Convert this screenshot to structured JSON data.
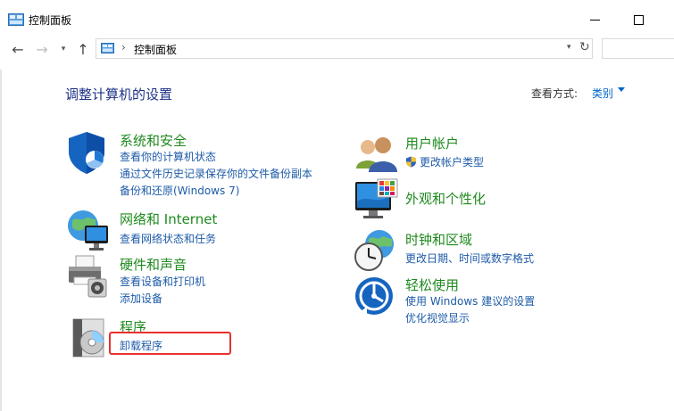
{
  "window": {
    "title": "控制面板"
  },
  "address": {
    "path": "控制面板"
  },
  "page": {
    "title": "调整计算机的设置",
    "view_by_label": "查看方式:",
    "view_by_value": "类别"
  },
  "categories": {
    "system_security": {
      "title": "系统和安全",
      "links": [
        "查看你的计算机状态",
        "通过文件历史记录保存你的文件备份副本",
        "备份和还原(Windows 7)"
      ]
    },
    "network": {
      "title": "网络和 Internet",
      "links": [
        "查看网络状态和任务"
      ]
    },
    "hardware": {
      "title": "硬件和声音",
      "links": [
        "查看设备和打印机",
        "添加设备"
      ]
    },
    "programs": {
      "title": "程序",
      "links": [
        "卸载程序"
      ]
    },
    "user_accounts": {
      "title": "用户帐户",
      "links": [
        "更改帐户类型"
      ]
    },
    "appearance": {
      "title": "外观和个性化",
      "links": []
    },
    "clock_region": {
      "title": "时钟和区域",
      "links": [
        "更改日期、时间或数字格式"
      ]
    },
    "ease_access": {
      "title": "轻松使用",
      "links": [
        "使用 Windows 建议的设置",
        "优化视觉显示"
      ]
    }
  },
  "colors": {
    "title_blue": "#1e3287",
    "category_green": "#1e8a1e",
    "link_blue": "#1e5ba8",
    "highlight_red": "#e8312f"
  }
}
